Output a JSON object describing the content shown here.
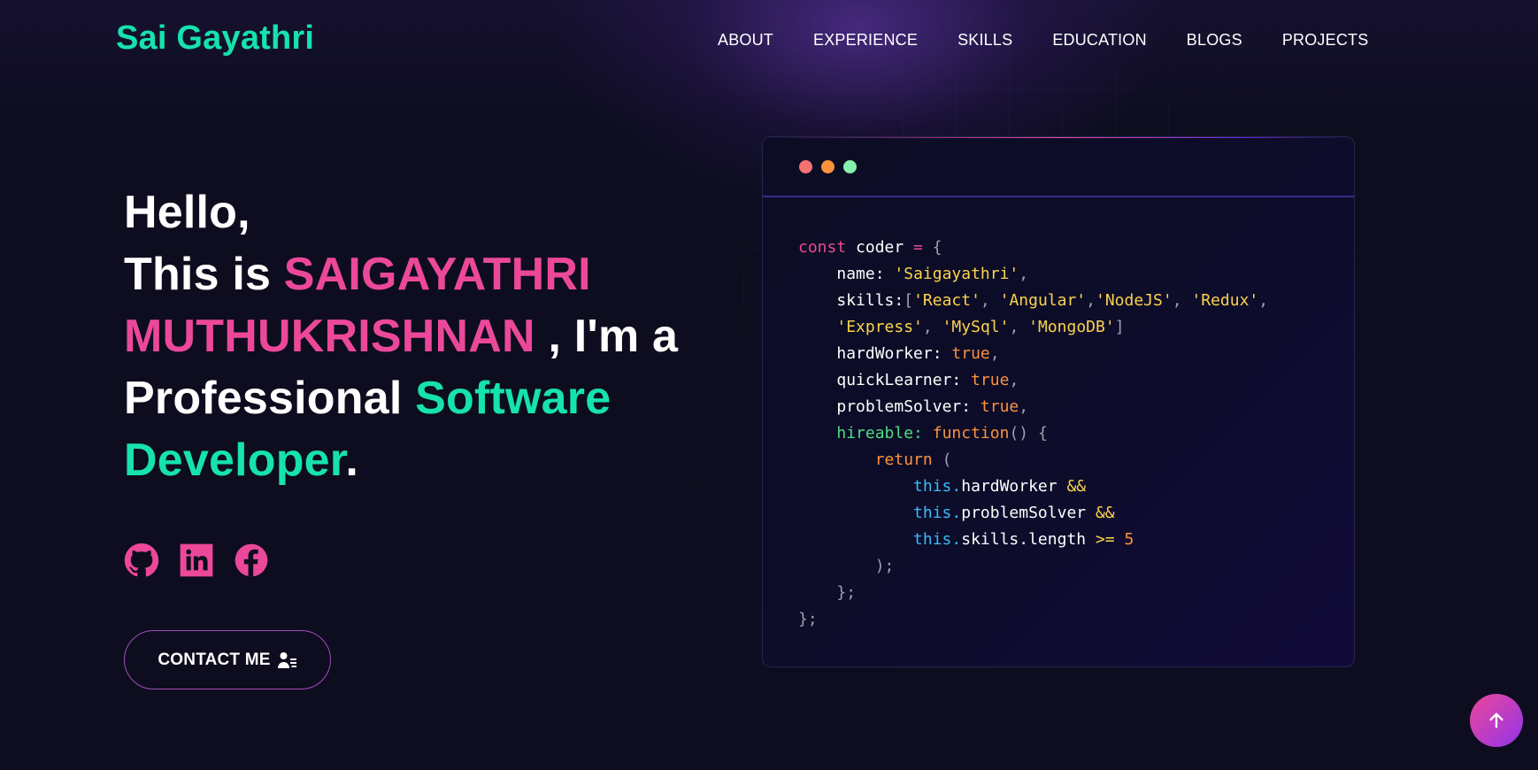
{
  "brand": {
    "name": "Sai Gayathri",
    "accent": "#16e2ad"
  },
  "nav": {
    "items": [
      {
        "label": "ABOUT"
      },
      {
        "label": "EXPERIENCE"
      },
      {
        "label": "SKILLS"
      },
      {
        "label": "EDUCATION"
      },
      {
        "label": "BLOGS"
      },
      {
        "label": "PROJECTS"
      }
    ]
  },
  "hero": {
    "greeting": "Hello,",
    "intro": "This is ",
    "name": "SAIGAYATHRI MUTHUKRISHNAN",
    "after_name": " , I'm a Professional ",
    "role": "Software Developer",
    "end": ".",
    "colors": {
      "name": "#ec4899",
      "role": "#16e2ad"
    }
  },
  "socials": [
    {
      "icon": "github-icon"
    },
    {
      "icon": "linkedin-icon"
    },
    {
      "icon": "facebook-icon"
    }
  ],
  "contact_button": {
    "label": "CONTACT ME",
    "icon": "user-list-icon"
  },
  "code": {
    "dot_colors": [
      "#f87171",
      "#fb923c",
      "#86efac"
    ],
    "l1_kw": "const",
    "l1_name": " coder ",
    "l1_eq": "=",
    "l1_brace": " {",
    "name_key": "name: ",
    "name_val": "'Saigayathri'",
    "skills_key": "skills:",
    "skill_react": "'React'",
    "skill_angular": "'Angular'",
    "skill_node": "'NodeJS'",
    "skill_redux": "'Redux'",
    "skill_express": "'Express'",
    "skill_mysql": "'MySql'",
    "skill_mongo": "'MongoDB'",
    "hw_key": "hardWorker: ",
    "ql_key": "quickLearner: ",
    "ps_key": "problemSolver: ",
    "true_val": "true",
    "hire_key": "hireable: ",
    "hire_fn": "function",
    "hire_paren": "() {",
    "return_kw": "return",
    "return_paren": " (",
    "this_kw": "this.",
    "cond1": "hardWorker ",
    "cond2": "problemSolver ",
    "cond3": "skills.length ",
    "and_op": "&&",
    "gte_op": ">=",
    "five": "5",
    "close_paren": ");",
    "close_fn": "};",
    "close_obj": "};"
  },
  "scroll_top": {
    "icon": "arrow-up-icon"
  }
}
